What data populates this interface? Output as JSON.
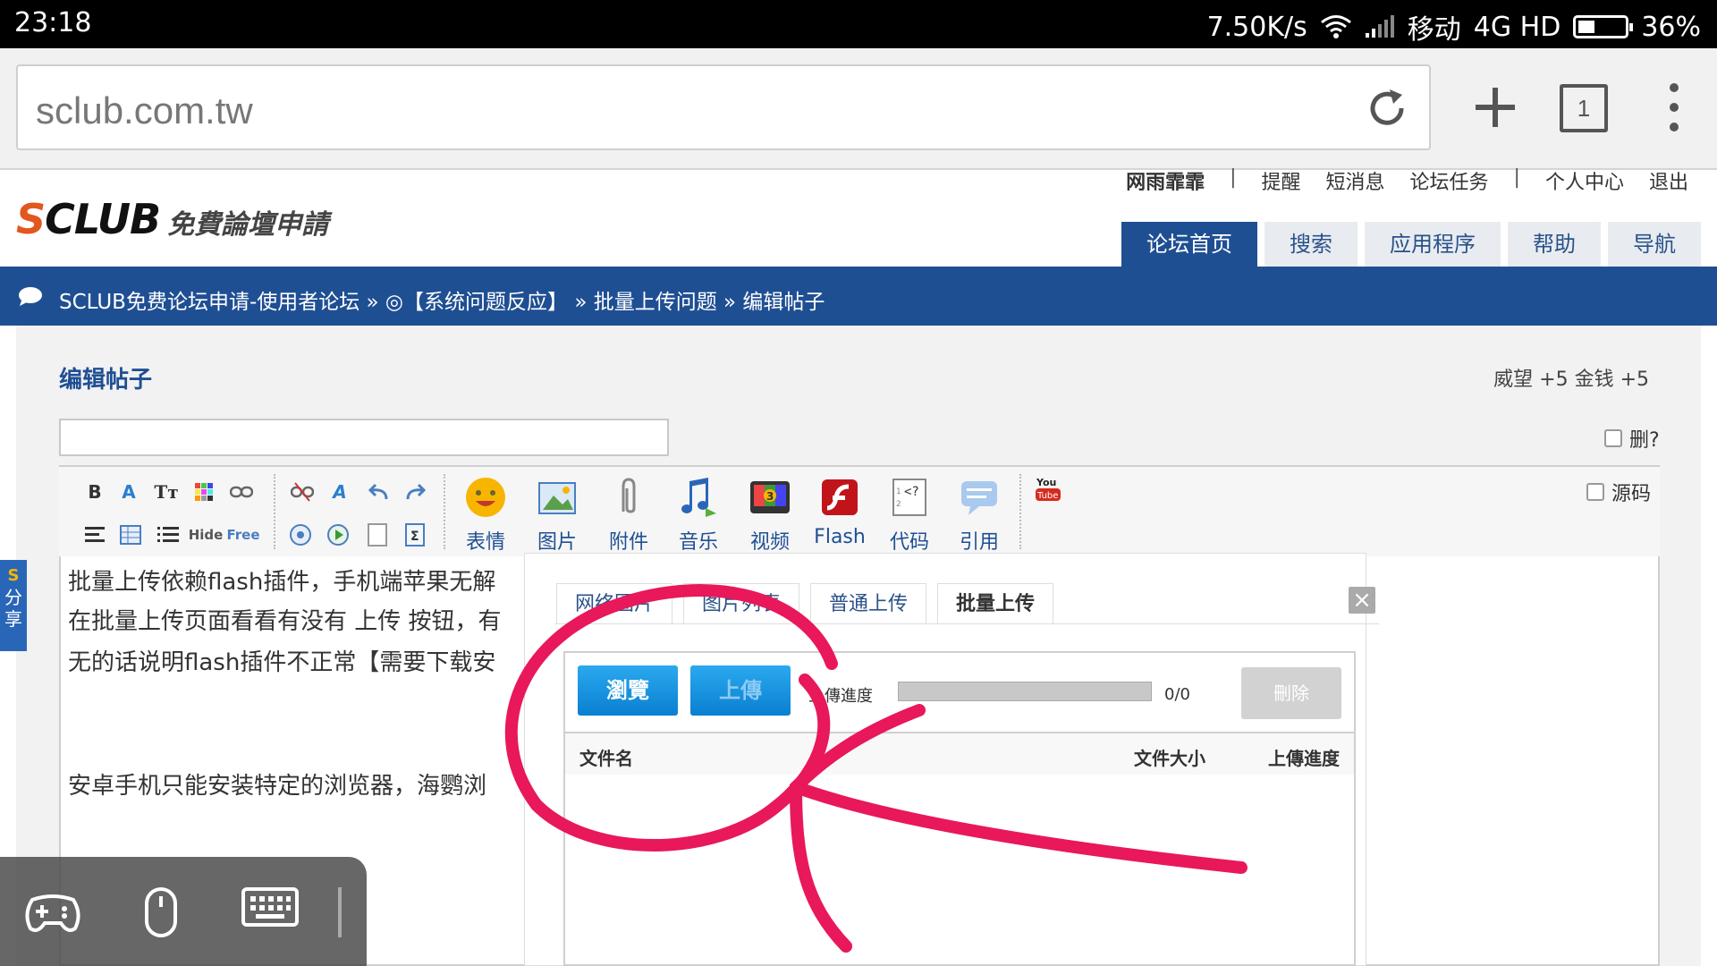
{
  "status_bar": {
    "time": "23:18",
    "network_speed": "7.50K/s",
    "carrier": "移动",
    "network_type": "4G HD",
    "battery": "36%",
    "battery_level": 0.36
  },
  "browser": {
    "url": "sclub.com.tw",
    "tab_count": "1"
  },
  "header": {
    "logo_brand": "SCLUB",
    "logo_tagline": "免費論壇申請",
    "user_links": [
      "网雨霏霏",
      "提醒",
      "短消息",
      "论坛任务",
      "个人中心",
      "退出"
    ],
    "main_nav": [
      "论坛首页",
      "搜索",
      "应用程序",
      "帮助",
      "导航"
    ],
    "active_nav": "论坛首页"
  },
  "breadcrumb": {
    "text": "SCLUB免费论坛申请-使用者论坛 » ◎【系统问题反应】 » 批量上传问题 » 编辑帖子"
  },
  "page": {
    "title": "编辑帖子",
    "points": "威望 +5  金钱 +5",
    "delete_checkbox": "删?",
    "source_checkbox": "源码"
  },
  "toolbar": {
    "big_buttons": [
      "表情",
      "图片",
      "附件",
      "音乐",
      "视频",
      "Flash",
      "代码",
      "引用"
    ],
    "hide_label": "Hide",
    "free_label": "Free"
  },
  "editor": {
    "lines": [
      "批量上传依赖flash插件，手机端苹果无解",
      "在批量上传页面看看有没有 上传 按钮，有",
      "无的话说明flash插件不正常【需要下载安",
      "",
      "安卓手机只能安装特定的浏览器，海鹦浏"
    ]
  },
  "share_tab": {
    "label_1": "分",
    "label_2": "享"
  },
  "upload_dialog": {
    "tabs": [
      "网络图片",
      "图片列表",
      "普通上传",
      "批量上传"
    ],
    "active_tab": "批量上传",
    "browse_button": "瀏覽",
    "upload_button": "上傳",
    "progress_label": "上傳進度",
    "progress_count": "0/0",
    "delete_button": "刪除",
    "columns": [
      "文件名",
      "文件大小",
      "上傳進度"
    ]
  },
  "colors": {
    "brand_blue": "#1f4f93",
    "annotation_red": "#e8185a",
    "button_blue": "#0a7fd0"
  }
}
